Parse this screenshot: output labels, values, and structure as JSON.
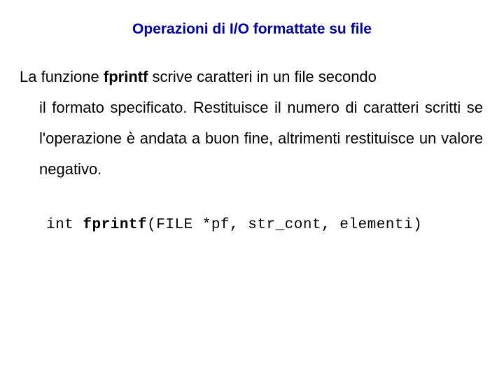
{
  "title": "Operazioni di I/O formattate su file",
  "para_part1": "La funzione ",
  "para_bold": "fprintf",
  "para_part2": " scrive caratteri in un file secondo",
  "para_indent": "il formato specificato. Restituisce il numero di caratteri scritti se l'operazione è andata a buon fine, altrimenti restituisce un valore negativo.",
  "code_pre": "int ",
  "code_fn": "fprintf",
  "code_post": "(FILE *pf, str_cont, elementi)"
}
